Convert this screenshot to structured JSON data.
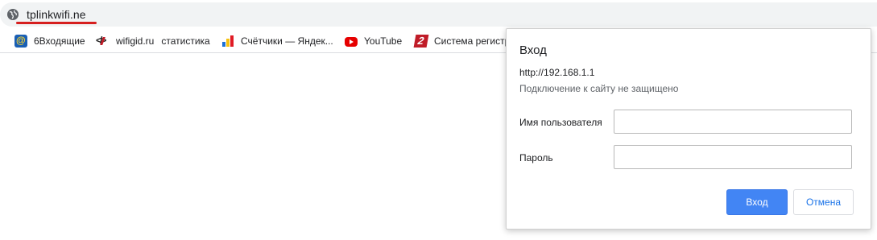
{
  "omnibox": {
    "url_text": "tplinkwifi.ne",
    "icon": "globe-icon",
    "underline_color": "#d61f1f"
  },
  "bookmarks": [
    {
      "label": "6Входящие",
      "icon": "mail-icon"
    },
    {
      "label": "wifigid.ru",
      "label2": "статистика",
      "icon": "wifigid-icon"
    },
    {
      "label": "Счётчики — Яндек...",
      "icon": "metrika-icon"
    },
    {
      "label": "YouTube",
      "icon": "youtube-icon"
    },
    {
      "label": "Система регистр",
      "icon": "registration-icon"
    }
  ],
  "overflow_label": "»",
  "dialog": {
    "title": "Вход",
    "url": "http://192.168.1.1",
    "warning": "Подключение к сайту не защищено",
    "username_label": "Имя пользователя",
    "username_value": "",
    "password_label": "Пароль",
    "password_value": "",
    "ok_label": "Вход",
    "cancel_label": "Отмена",
    "accent_color": "#4285f4"
  }
}
